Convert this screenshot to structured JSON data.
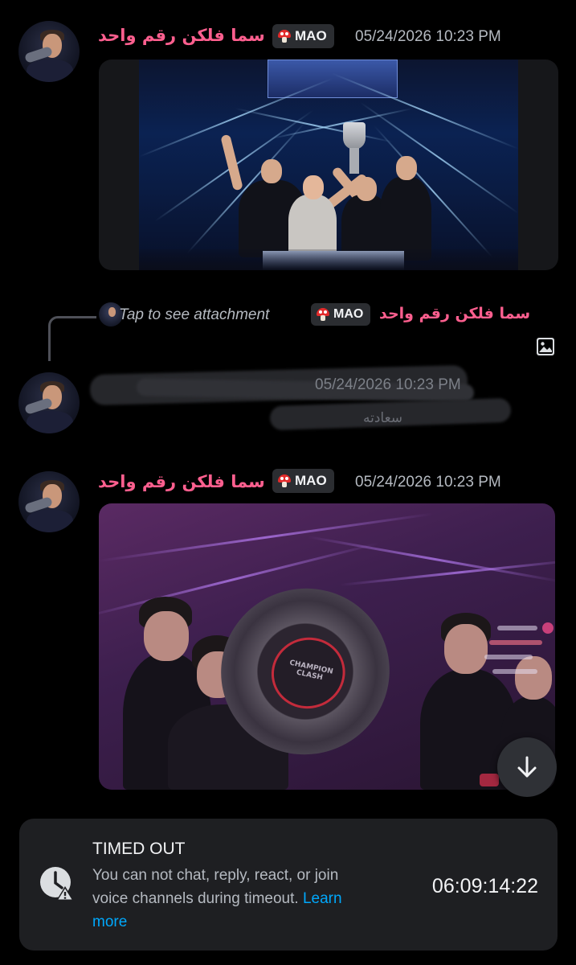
{
  "messages": [
    {
      "username": "سما فلكن رقم واحد",
      "tag": "MAO",
      "timestamp": "05/24/2026 10:23 PM"
    },
    {
      "reply": {
        "preview": "Tap to see attachment",
        "tag": "MAO",
        "username": "سما فلكن رقم واحد"
      },
      "timestamp": "05/24/2026 10:23 PM",
      "body_fragment": "سعادته"
    },
    {
      "username": "سما فلكن رقم واحد",
      "tag": "MAO",
      "timestamp": "05/24/2026 10:23 PM"
    }
  ],
  "timeout_banner": {
    "title": "TIMED OUT",
    "description": "You can not chat, reply, react, or join voice channels during timeout.",
    "link": "Learn more",
    "countdown": "06:09:14:22"
  },
  "icons": {
    "role_badge": "mushroom-icon",
    "attachment": "image-icon",
    "scroll": "arrow-down-icon",
    "timeout": "clock-warning-icon"
  },
  "colors": {
    "background": "#000000",
    "username": "#ff5f8f",
    "tag_bg": "#2b2d31",
    "link": "#00a8fc",
    "banner_bg": "#1e1f22"
  }
}
